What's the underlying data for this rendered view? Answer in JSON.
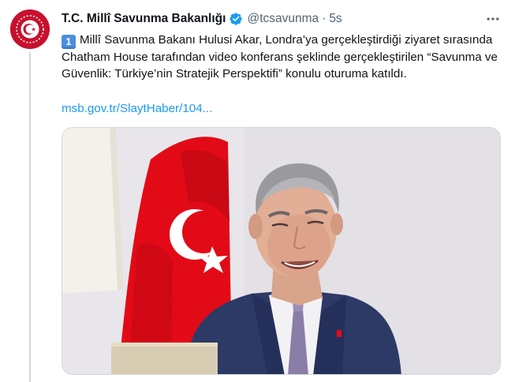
{
  "author": {
    "display_name": "T.C. Millî Savunma Bakanlığı",
    "handle": "@tcsavunma",
    "separator": "·",
    "time": "5s"
  },
  "tweet": {
    "keycap": "1",
    "text": "Millî Savunma Bakanı Hulusi Akar, Londra’ya gerçekleştirdiği ziyaret sırasında Chatham House tarafından video konferans şeklinde gerçekleştirilen “Savunma ve Güvenlik: Türkiye’nin Stratejik Perspektifi” konulu oturuma katıldı.",
    "link": "msb.gov.tr/SlaytHaber/104..."
  },
  "icons": {
    "avatar": "ministry-emblem-icon",
    "verified": "verified-badge-icon",
    "more": "more-options-icon",
    "keycap": "keycap-one-emoji"
  },
  "colors": {
    "link": "#1d9bf0",
    "verified": "#1d9bf0",
    "muted": "#536471",
    "flag_red": "#e30a17",
    "emblem_red": "#c8102e"
  }
}
